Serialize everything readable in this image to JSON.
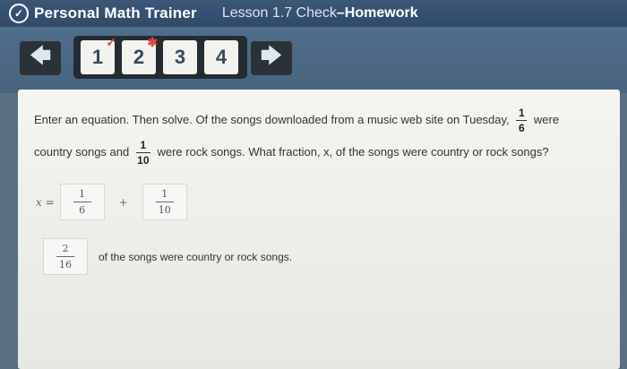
{
  "header": {
    "app_name": "Personal Math Trainer",
    "lesson": "Lesson 1.7 Check",
    "separator": "–",
    "assignment": "Homework"
  },
  "nav": {
    "prev_arrow": "🡄",
    "next_arrow": "🡆",
    "steps": [
      "1",
      "2",
      "3",
      "4"
    ],
    "step_marks": [
      "✓",
      "✱",
      "",
      ""
    ]
  },
  "question": {
    "line1": "Enter an equation. Then solve. Of the songs downloaded from a music web site on Tuesday,",
    "frac1_num": "1",
    "frac1_den": "6",
    "line1_end": "were",
    "line2_start": "country songs and",
    "frac2_num": "1",
    "frac2_den": "10",
    "line2_end": "were rock songs. What fraction, x, of the songs were country or rock songs?"
  },
  "equation": {
    "lhs": "x =",
    "term1_num": "1",
    "term1_den": "6",
    "operator": "+",
    "term2_num": "1",
    "term2_den": "10"
  },
  "answer": {
    "num": "2",
    "den": "16",
    "text": "of the songs were country or rock songs."
  },
  "colors": {
    "accent": "#2f4b6a",
    "incorrect_mark": "#d64b3a"
  },
  "icons": {
    "logo": "pmt-logo-icon",
    "prev": "arrow-left-icon",
    "next": "arrow-right-icon"
  }
}
